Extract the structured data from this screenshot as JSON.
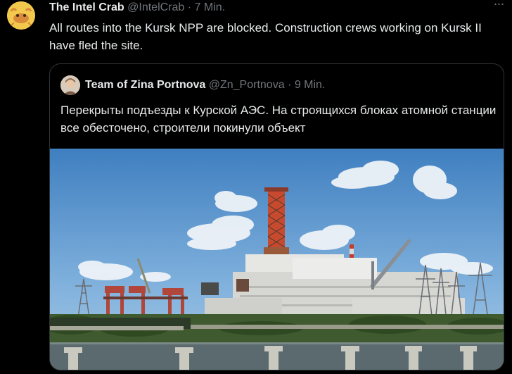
{
  "tweet": {
    "author": {
      "name": "The Intel Crab",
      "handle": "@IntelCrab",
      "time": "· 7 Min."
    },
    "more_glyph": "···",
    "text": "All routes into the Kursk NPP are blocked. Construction crews working on Kursk II have fled the site."
  },
  "quoted": {
    "author": {
      "name": "Team of Zina Portnova",
      "handle": "@Zn_Portnova",
      "time": "· 9 Min."
    },
    "text": "Перекрыты подъезды к Курской АЭС. На строящихся блоках атомной станции все обесточено, строители покинули объект"
  },
  "colors": {
    "background": "#000000",
    "text": "#e7e9ea",
    "muted": "#71767b",
    "border": "#2f3336"
  }
}
